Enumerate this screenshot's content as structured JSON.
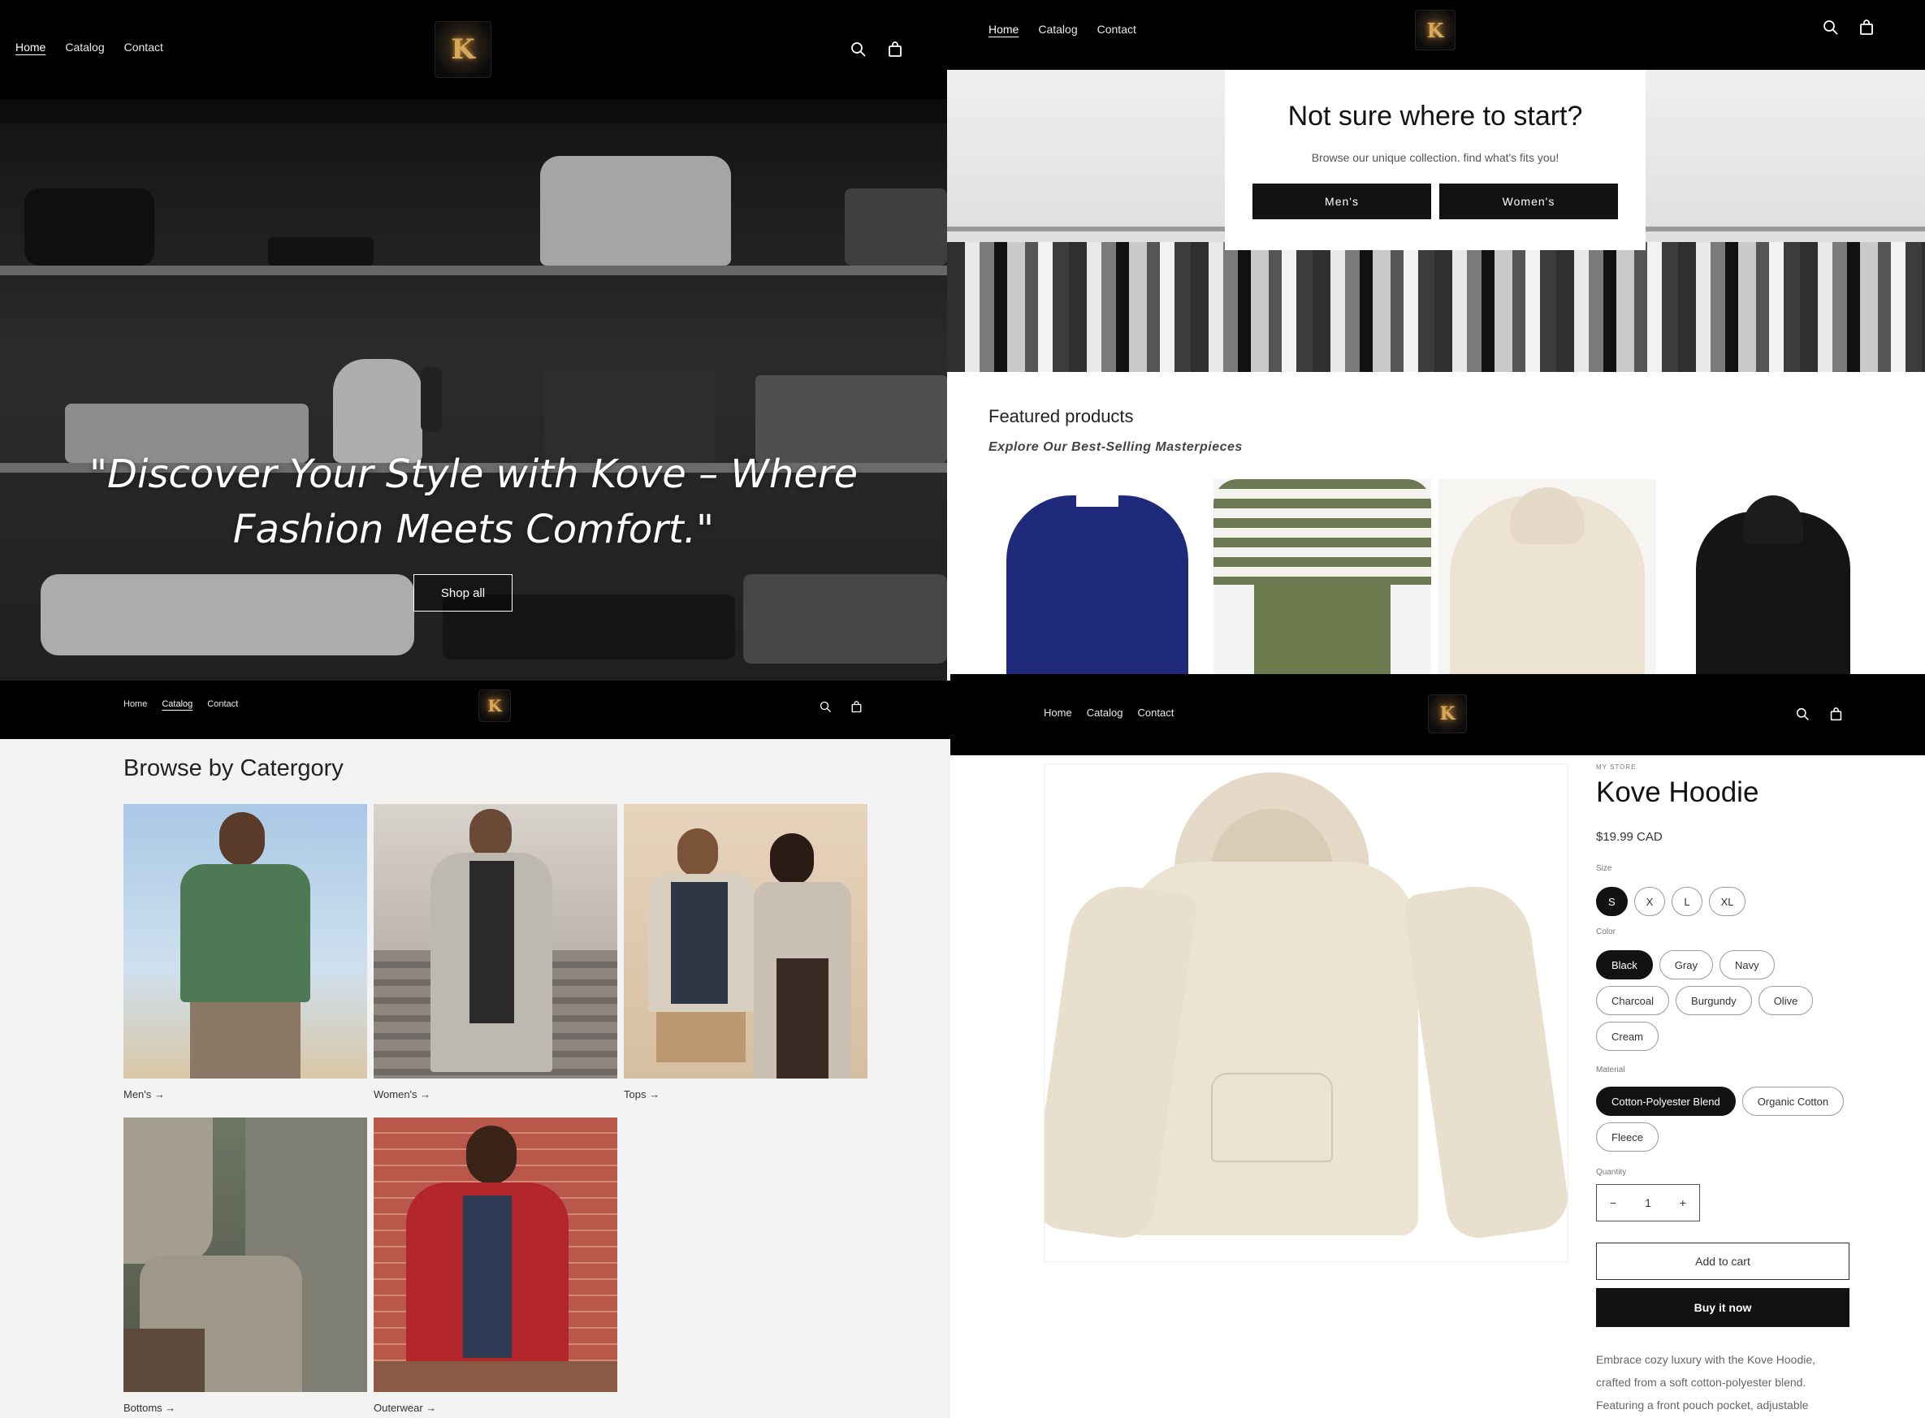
{
  "nav": {
    "home": "Home",
    "catalog": "Catalog",
    "contact": "Contact"
  },
  "logo": {
    "letter": "K"
  },
  "hero": {
    "quote_line1": "\"Discover Your Style with Kove – Where",
    "quote_line2": "Fashion Meets Comfort.\"",
    "cta": "Shop all"
  },
  "start": {
    "heading": "Not sure where to start?",
    "subtitle": "Browse our unique collection. find what's fits you!",
    "mens_btn": "Men's",
    "womens_btn": "Women's"
  },
  "featured": {
    "heading": "Featured products",
    "subheading": "Explore Our Best-Selling Masterpieces"
  },
  "category": {
    "heading": "Browse by Catergory",
    "items": [
      {
        "label": "Men's →"
      },
      {
        "label": "Women's →"
      },
      {
        "label": "Tops →"
      },
      {
        "label": "Bottoms →"
      },
      {
        "label": "Outerwear →"
      }
    ]
  },
  "product": {
    "vendor": "MY STORE",
    "title": "Kove Hoodie",
    "price": "$19.99 CAD",
    "size_label": "Size",
    "sizes": [
      "S",
      "X",
      "L",
      "XL"
    ],
    "color_label": "Color",
    "colors": [
      "Black",
      "Gray",
      "Navy",
      "Charcoal",
      "Burgundy",
      "Olive",
      "Cream"
    ],
    "material_label": "Material",
    "materials": [
      "Cotton-Polyester Blend",
      "Organic Cotton",
      "Fleece"
    ],
    "quantity_label": "Quantity",
    "quantity": "1",
    "minus": "−",
    "plus": "+",
    "add_to_cart": "Add to cart",
    "buy_now": "Buy it now",
    "desc_line1": "Embrace cozy luxury with the Kove Hoodie,",
    "desc_line2": "crafted from a soft cotton-polyester blend.",
    "desc_line3": "Featuring a front pouch pocket, adjustable"
  },
  "colors": {
    "header_bg": "#000000",
    "button_dark": "#121212",
    "category_bg": "#f3f3f3",
    "hoodie": "#ece3d3"
  }
}
